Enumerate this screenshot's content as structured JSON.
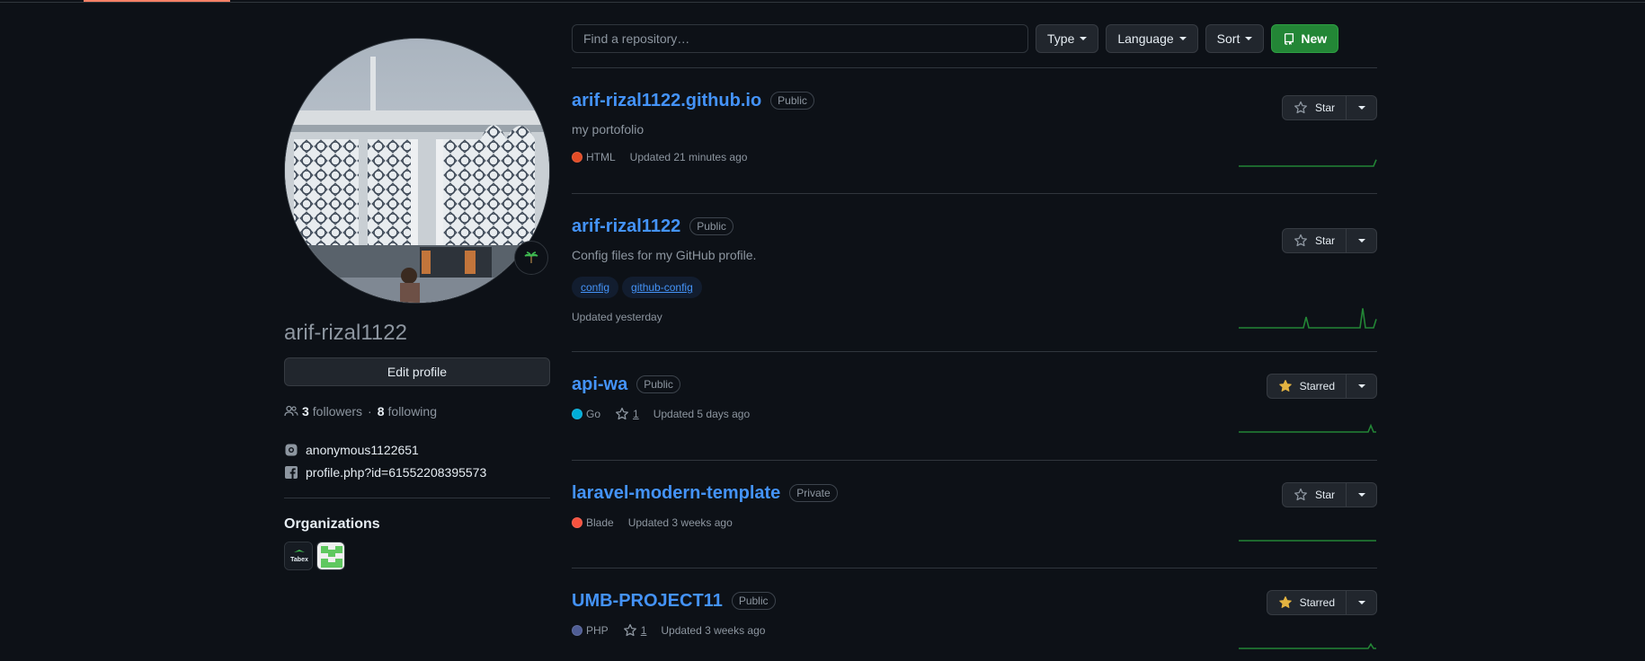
{
  "search": {
    "placeholder": "Find a repository…"
  },
  "filters": {
    "type": "Type",
    "language": "Language",
    "sort": "Sort",
    "new": "New"
  },
  "profile": {
    "username": "arif-rizal1122",
    "edit_label": "Edit profile",
    "followers_count": "3",
    "followers_label": "followers",
    "following_count": "8",
    "following_label": "following",
    "separator": "·",
    "instagram": "anonymous1122651",
    "facebook": "profile.php?id=61552208395573",
    "org_title": "Organizations",
    "org_1_label": "Tabex"
  },
  "colors": {
    "html": "#e34c26",
    "go": "#00add8",
    "blade": "#f7523f",
    "php": "#4f5d95",
    "link": "#4493f8",
    "accent": "#238636",
    "star_gold": "#e3b341"
  },
  "repos": [
    {
      "name": "arif-rizal1122.github.io",
      "visibility": "Public",
      "description": "my portofolio",
      "language": "HTML",
      "updated": "Updated 21 minutes ago",
      "star_label": "Star",
      "starred": false,
      "activity": [
        0,
        0,
        0,
        0,
        0,
        0,
        0,
        0,
        0,
        0,
        0,
        0,
        0,
        0,
        0,
        0,
        0,
        0,
        0,
        0,
        0,
        0,
        0,
        0,
        0,
        0,
        0,
        0,
        0,
        0,
        0,
        0,
        0,
        0,
        0,
        0,
        0,
        0,
        0,
        0,
        0,
        0,
        0,
        0,
        0,
        0,
        0,
        0,
        0,
        0,
        0,
        3
      ]
    },
    {
      "name": "arif-rizal1122",
      "visibility": "Public",
      "description": "Config files for my GitHub profile.",
      "topics": [
        "config",
        "github-config"
      ],
      "updated": "Updated yesterday",
      "star_label": "Star",
      "starred": false,
      "activity": [
        0,
        0,
        0,
        0,
        0,
        0,
        0,
        0,
        0,
        0,
        0,
        0,
        0,
        0,
        0,
        0,
        0,
        0,
        0,
        0,
        0,
        0,
        0,
        0,
        0,
        5,
        0,
        0,
        0,
        0,
        0,
        0,
        0,
        0,
        0,
        0,
        0,
        0,
        0,
        0,
        0,
        0,
        0,
        0,
        0,
        0,
        9,
        0,
        0,
        0,
        0,
        4
      ]
    },
    {
      "name": "api-wa",
      "visibility": "Public",
      "language": "Go",
      "stars": "1",
      "updated": "Updated 5 days ago",
      "star_label": "Starred",
      "starred": true,
      "activity": [
        0,
        0,
        0,
        0,
        0,
        0,
        0,
        0,
        0,
        0,
        0,
        0,
        0,
        0,
        0,
        0,
        0,
        0,
        0,
        0,
        0,
        0,
        0,
        0,
        0,
        0,
        0,
        0,
        0,
        0,
        0,
        0,
        0,
        0,
        0,
        0,
        0,
        0,
        0,
        0,
        0,
        0,
        0,
        0,
        0,
        0,
        0,
        0,
        0,
        3,
        0,
        0
      ]
    },
    {
      "name": "laravel-modern-template",
      "visibility": "Private",
      "language": "Blade",
      "updated": "Updated 3 weeks ago",
      "star_label": "Star",
      "starred": false,
      "activity": [
        0,
        0,
        0,
        0,
        0,
        0,
        0,
        0,
        0,
        0,
        0,
        0,
        0,
        0,
        0,
        0,
        0,
        0,
        0,
        0,
        0,
        0,
        0,
        0,
        0,
        0,
        0,
        0,
        0,
        0,
        0,
        0,
        0,
        0,
        0,
        0,
        0,
        0,
        0,
        0,
        0,
        0,
        0,
        0,
        0,
        0,
        0,
        0,
        0,
        0,
        0,
        0
      ]
    },
    {
      "name": "UMB-PROJECT11",
      "visibility": "Public",
      "language": "PHP",
      "stars": "1",
      "updated": "Updated 3 weeks ago",
      "star_label": "Starred",
      "starred": true,
      "activity": [
        0,
        0,
        0,
        0,
        0,
        0,
        0,
        0,
        0,
        0,
        0,
        0,
        0,
        0,
        0,
        0,
        0,
        0,
        0,
        0,
        0,
        0,
        0,
        0,
        0,
        0,
        0,
        0,
        0,
        0,
        0,
        0,
        0,
        0,
        0,
        0,
        0,
        0,
        0,
        0,
        0,
        0,
        0,
        0,
        0,
        0,
        0,
        0,
        0,
        2,
        0,
        0
      ]
    }
  ]
}
